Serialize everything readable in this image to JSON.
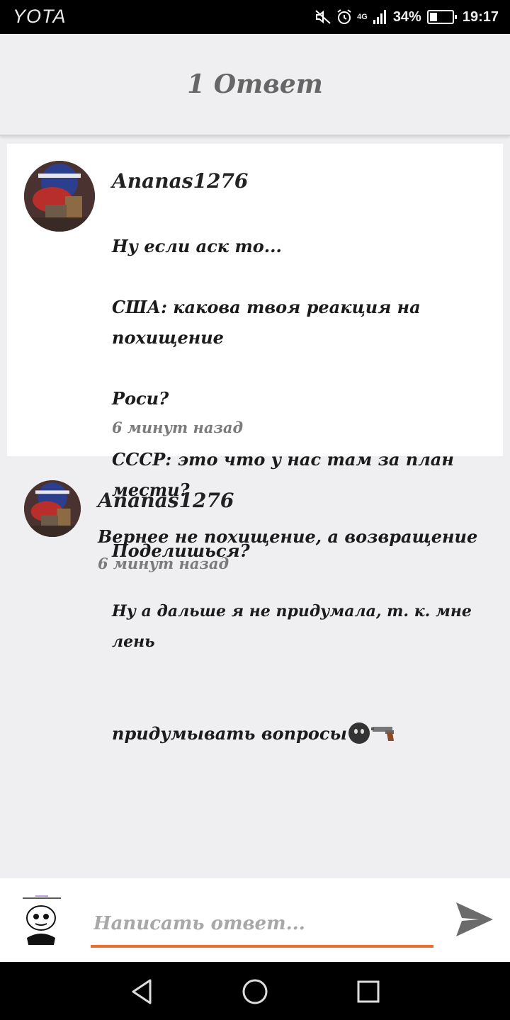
{
  "status_bar": {
    "carrier": "YOTA",
    "network": "4G",
    "battery": "34%",
    "battery_level": 0.34,
    "time": "19:17"
  },
  "header": {
    "title": "1 Ответ"
  },
  "comment": {
    "author": "Ananas1276",
    "text_lines": [
      "Ну если аск то...",
      "США: какова твоя реакция на похищение",
      "Роси?",
      "СССР: это что у нас там за план мести?",
      "Поделишься?",
      "Ну а дальше я не придумала, т. к. мне лень",
      "придумывать вопросы"
    ],
    "time": "6 минут назад"
  },
  "reply": {
    "author": "Ananas1276",
    "text": "Вернее не похищение, а возвращение",
    "time": "6 минут назад"
  },
  "input": {
    "placeholder": "Написать ответ..."
  },
  "colors": {
    "accent": "#ef6c2f",
    "background": "#efeef1",
    "card": "#ffffff"
  }
}
